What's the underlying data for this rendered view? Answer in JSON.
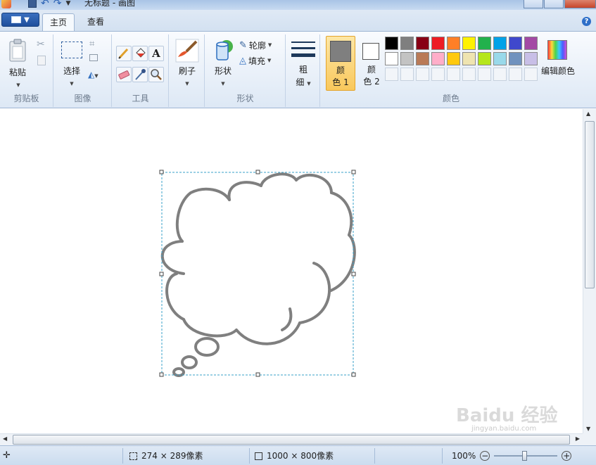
{
  "window": {
    "title": "无标题 - 画图"
  },
  "tabs": {
    "home": "主页",
    "view": "查看"
  },
  "groups": {
    "clipboard": {
      "label": "剪贴板",
      "paste": "粘贴"
    },
    "image": {
      "label": "图像",
      "select": "选择"
    },
    "tools": {
      "label": "工具"
    },
    "brushes": {
      "label": "刷子"
    },
    "shapes": {
      "label": "形状",
      "shapes_btn": "形状",
      "outline": "轮廓",
      "fill": "填充"
    },
    "size": {
      "label_line1": "粗",
      "label_line2": "细"
    },
    "colors": {
      "label": "颜色",
      "color1_line1": "颜",
      "color1_line2": "色 1",
      "color2_line1": "颜",
      "color2_line2": "色 2",
      "edit_colors": "编辑颜色"
    }
  },
  "palette": {
    "row1": [
      "#000000",
      "#7f7f7f",
      "#880015",
      "#ed1c24",
      "#ff7f27",
      "#fff200",
      "#22b14c",
      "#00a2e8",
      "#3f48cc",
      "#a349a4"
    ],
    "row2": [
      "#ffffff",
      "#c3c3c3",
      "#b97a57",
      "#ffaec9",
      "#ffc90e",
      "#efe4b0",
      "#b5e61d",
      "#99d9ea",
      "#7092be",
      "#c8bfe7"
    ],
    "color1": "#7f7f7f",
    "color2": "#ffffff"
  },
  "status": {
    "selection_size": "274 × 289像素",
    "canvas_size": "1000 × 800像素",
    "zoom": "100%"
  },
  "watermark": {
    "text": "Baidu 经验",
    "sub": "jingyan.baidu.com"
  }
}
